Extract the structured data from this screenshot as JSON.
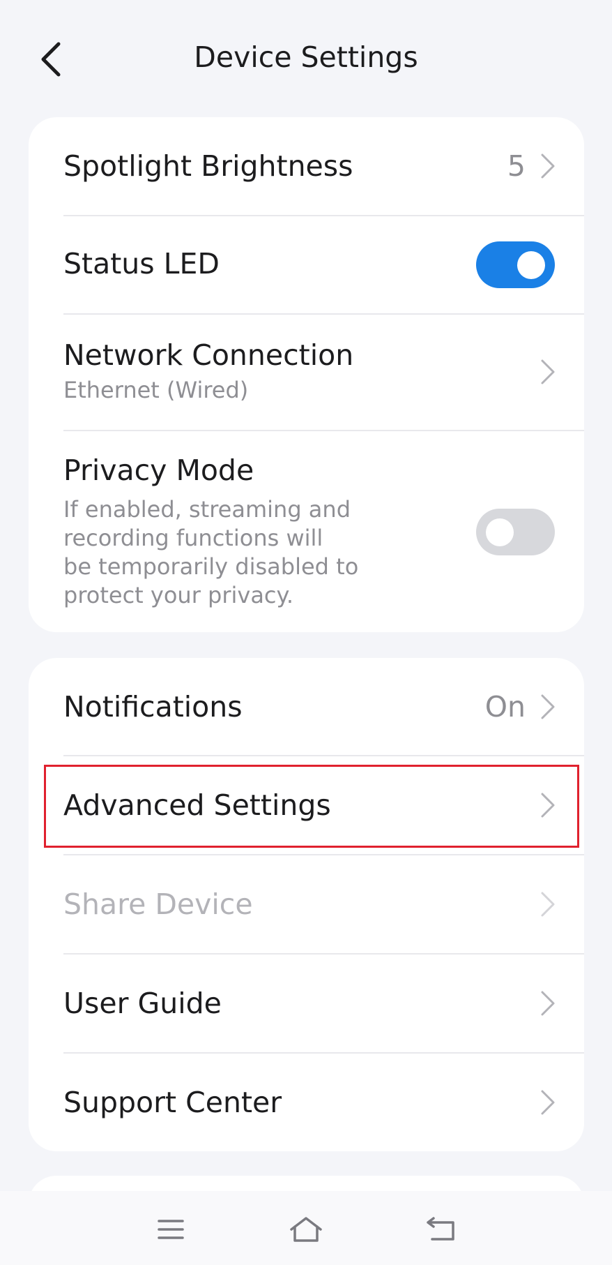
{
  "header": {
    "title": "Device Settings",
    "back_icon": "chevron-left-icon"
  },
  "section1": {
    "spotlight": {
      "label": "Spotlight Brightness",
      "value": "5"
    },
    "status_led": {
      "label": "Status LED",
      "enabled": true
    },
    "network": {
      "label": "Network Connection",
      "sub": "Ethernet (Wired)"
    },
    "privacy": {
      "label": "Privacy Mode",
      "sub_lines": [
        "If enabled, streaming and",
        "recording functions will",
        "be temporarily disabled to",
        "protect your privacy."
      ],
      "enabled": false
    }
  },
  "section2": {
    "notifications": {
      "label": "Notifications",
      "value": "On"
    },
    "advanced": {
      "label": "Advanced Settings"
    },
    "share": {
      "label": "Share Device",
      "disabled": true
    },
    "guide": {
      "label": "User Guide"
    },
    "support": {
      "label": "Support Center"
    }
  },
  "navbar": {
    "items": [
      "menu-icon",
      "home-icon",
      "back-icon"
    ]
  },
  "colors": {
    "accent": "#1a80e6",
    "highlight": "#e0212e",
    "background": "#f4f5f9"
  }
}
